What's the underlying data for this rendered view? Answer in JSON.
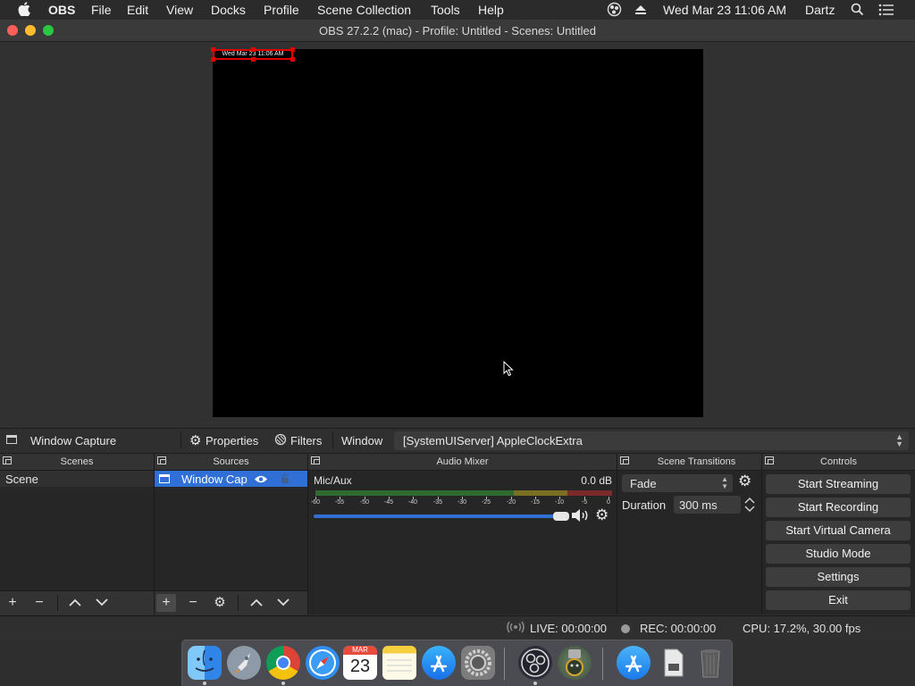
{
  "menubar": {
    "apple": "",
    "app": "OBS",
    "items": [
      "File",
      "Edit",
      "View",
      "Docks",
      "Profile",
      "Scene Collection",
      "Tools",
      "Help"
    ],
    "clock": "Wed Mar 23  11:06 AM",
    "user": "Dartz"
  },
  "window": {
    "title": "OBS 27.2.2 (mac) - Profile: Untitled - Scenes: Untitled"
  },
  "preview": {
    "clock_overlay": "Wed Mar 23 11:06 AM"
  },
  "source_toolbar": {
    "source_name": "Window Capture",
    "properties_label": "Properties",
    "filters_label": "Filters",
    "window_label": "Window",
    "window_value": "[SystemUIServer] AppleClockExtra"
  },
  "scenes": {
    "title": "Scenes",
    "items": [
      "Scene"
    ]
  },
  "sources": {
    "title": "Sources",
    "items": [
      "Window Cap"
    ]
  },
  "audio_mixer": {
    "title": "Audio Mixer",
    "channel": "Mic/Aux",
    "level": "0.0 dB",
    "ticks": [
      "-60",
      "-55",
      "-50",
      "-45",
      "-40",
      "-35",
      "-30",
      "-25",
      "-20",
      "-15",
      "-10",
      "-5",
      "0"
    ],
    "volume_fraction": 1.0
  },
  "transitions": {
    "title": "Scene Transitions",
    "type": "Fade",
    "duration_label": "Duration",
    "duration_value": "300 ms"
  },
  "controls": {
    "title": "Controls",
    "buttons": [
      "Start Streaming",
      "Start Recording",
      "Start Virtual Camera",
      "Studio Mode",
      "Settings",
      "Exit"
    ]
  },
  "status": {
    "live": "LIVE: 00:00:00",
    "rec": "REC: 00:00:00",
    "cpu": "CPU: 17.2%, 30.00 fps"
  },
  "dock_apps": [
    {
      "name": "Finder",
      "icon": "finder-icon"
    },
    {
      "name": "Launchpad",
      "icon": "launchpad-icon"
    },
    {
      "name": "Chrome",
      "icon": "chrome-icon"
    },
    {
      "name": "Safari",
      "icon": "safari-icon"
    },
    {
      "name": "Calendar",
      "icon": "calendar-icon",
      "month": "MAR",
      "day": "23"
    },
    {
      "name": "Notes",
      "icon": "notes-icon"
    },
    {
      "name": "App Store",
      "icon": "appstore-icon"
    },
    {
      "name": "System Preferences",
      "icon": "system-preferences-icon"
    },
    {
      "name": "OBS",
      "icon": "obs-icon"
    },
    {
      "name": "Automator",
      "icon": "automator-icon"
    },
    {
      "name": "App Store Downloads",
      "icon": "appstore-folder-icon"
    },
    {
      "name": "Documents",
      "icon": "documents-icon"
    },
    {
      "name": "Trash",
      "icon": "trash-icon"
    }
  ],
  "colors": {
    "accent_blue": "#2f6fd6",
    "source_handle_red": "#e00000",
    "meter_green": "#4caf50",
    "meter_yellow": "#c7b530",
    "meter_red": "#d63b3b"
  }
}
